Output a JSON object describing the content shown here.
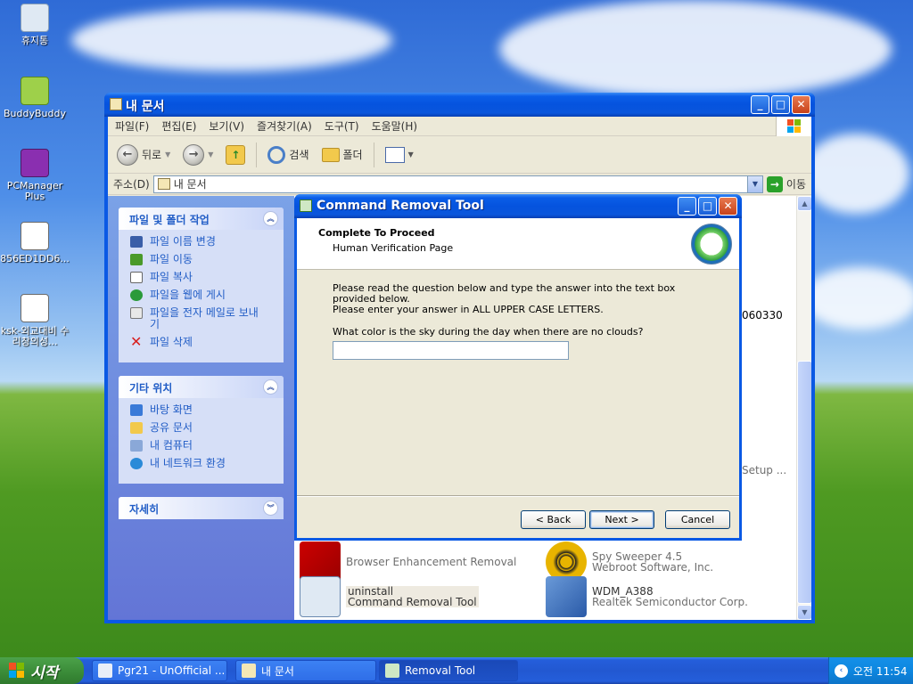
{
  "desktop": {
    "icons": [
      {
        "label": "휴지통",
        "icon": "recycle-bin-icon"
      },
      {
        "label": "BuddyBuddy",
        "icon": "buddybuddy-shortcut-icon"
      },
      {
        "label": "PCManager Plus",
        "icon": "pcmanager-plus-shortcut-icon"
      },
      {
        "label": "856ED1DD6...",
        "icon": "document-file-icon"
      },
      {
        "label": "ksk-외교대비 수리창의성...",
        "icon": "document-file-icon"
      }
    ]
  },
  "explorer": {
    "title": "내 문서",
    "menu": [
      "파일(F)",
      "편집(E)",
      "보기(V)",
      "즐겨찾기(A)",
      "도구(T)",
      "도움말(H)"
    ],
    "toolbar": {
      "back": "뒤로",
      "search": "검색",
      "folders": "폴더"
    },
    "address": {
      "label": "주소(D)",
      "value": "내 문서",
      "go": "이동"
    },
    "taskpane": {
      "file_tasks": {
        "title": "파일 및 폴더 작업",
        "items": [
          "파일 이름 변경",
          "파일 이동",
          "파일 복사",
          "파일을 웹에 게시",
          "파일을 전자 메일로 보내기",
          "파일 삭제"
        ]
      },
      "other_places": {
        "title": "기타 위치",
        "items": [
          "바탕 화면",
          "공유 문서",
          "내 컴퓨터",
          "내 네트워크 환경"
        ]
      },
      "details": {
        "title": "자세히"
      }
    },
    "files": {
      "partial_right_1": "060330",
      "partial_right_2": "Setup ...",
      "items": [
        {
          "name": "",
          "sub": "Browser Enhancement Removal"
        },
        {
          "name": "Spy Sweeper 4.5",
          "sub": "Webroot Software, Inc."
        },
        {
          "name": "uninstall",
          "sub": "Command Removal Tool"
        },
        {
          "name": "WDM_A388",
          "sub": "Realtek Semiconductor Corp."
        }
      ]
    }
  },
  "dialog": {
    "title": "Command Removal Tool",
    "header_title": "Complete To Proceed",
    "header_subtitle": "Human Verification Page",
    "instruction_1": "Please read the question below and type the answer into the text box provided below.",
    "instruction_2": "Please enter your answer in ALL UPPER CASE LETTERS.",
    "question": "What color is the sky during the day when there are no clouds?",
    "answer_value": "",
    "buttons": {
      "back": "< Back",
      "next": "Next >",
      "cancel": "Cancel"
    }
  },
  "taskbar": {
    "start_label": "시작",
    "tasks": [
      {
        "label": "Pgr21 - UnOfficial ..."
      },
      {
        "label": "내 문서"
      },
      {
        "label": "Removal Tool"
      }
    ],
    "clock": "오전 11:54"
  }
}
